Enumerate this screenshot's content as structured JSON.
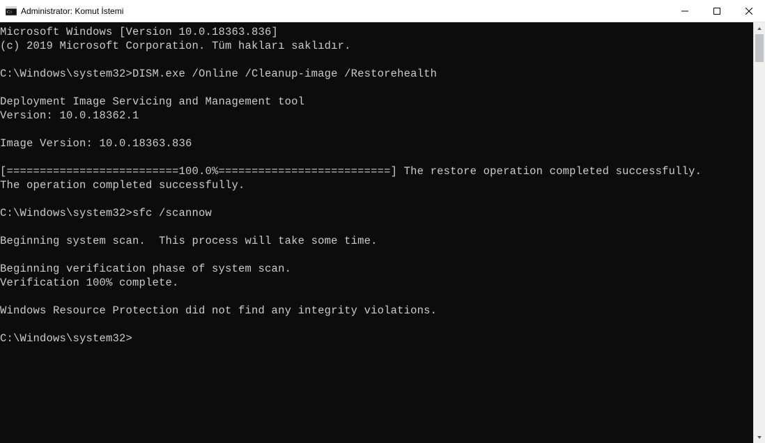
{
  "window": {
    "title": "Administrator: Komut İstemi"
  },
  "terminal": {
    "lines": [
      "Microsoft Windows [Version 10.0.18363.836]",
      "(c) 2019 Microsoft Corporation. Tüm hakları saklıdır.",
      "",
      "C:\\Windows\\system32>DISM.exe /Online /Cleanup-image /Restorehealth",
      "",
      "Deployment Image Servicing and Management tool",
      "Version: 10.0.18362.1",
      "",
      "Image Version: 10.0.18363.836",
      "",
      "[==========================100.0%==========================] The restore operation completed successfully.",
      "The operation completed successfully.",
      "",
      "C:\\Windows\\system32>sfc /scannow",
      "",
      "Beginning system scan.  This process will take some time.",
      "",
      "Beginning verification phase of system scan.",
      "Verification 100% complete.",
      "",
      "Windows Resource Protection did not find any integrity violations.",
      "",
      "C:\\Windows\\system32>"
    ]
  }
}
